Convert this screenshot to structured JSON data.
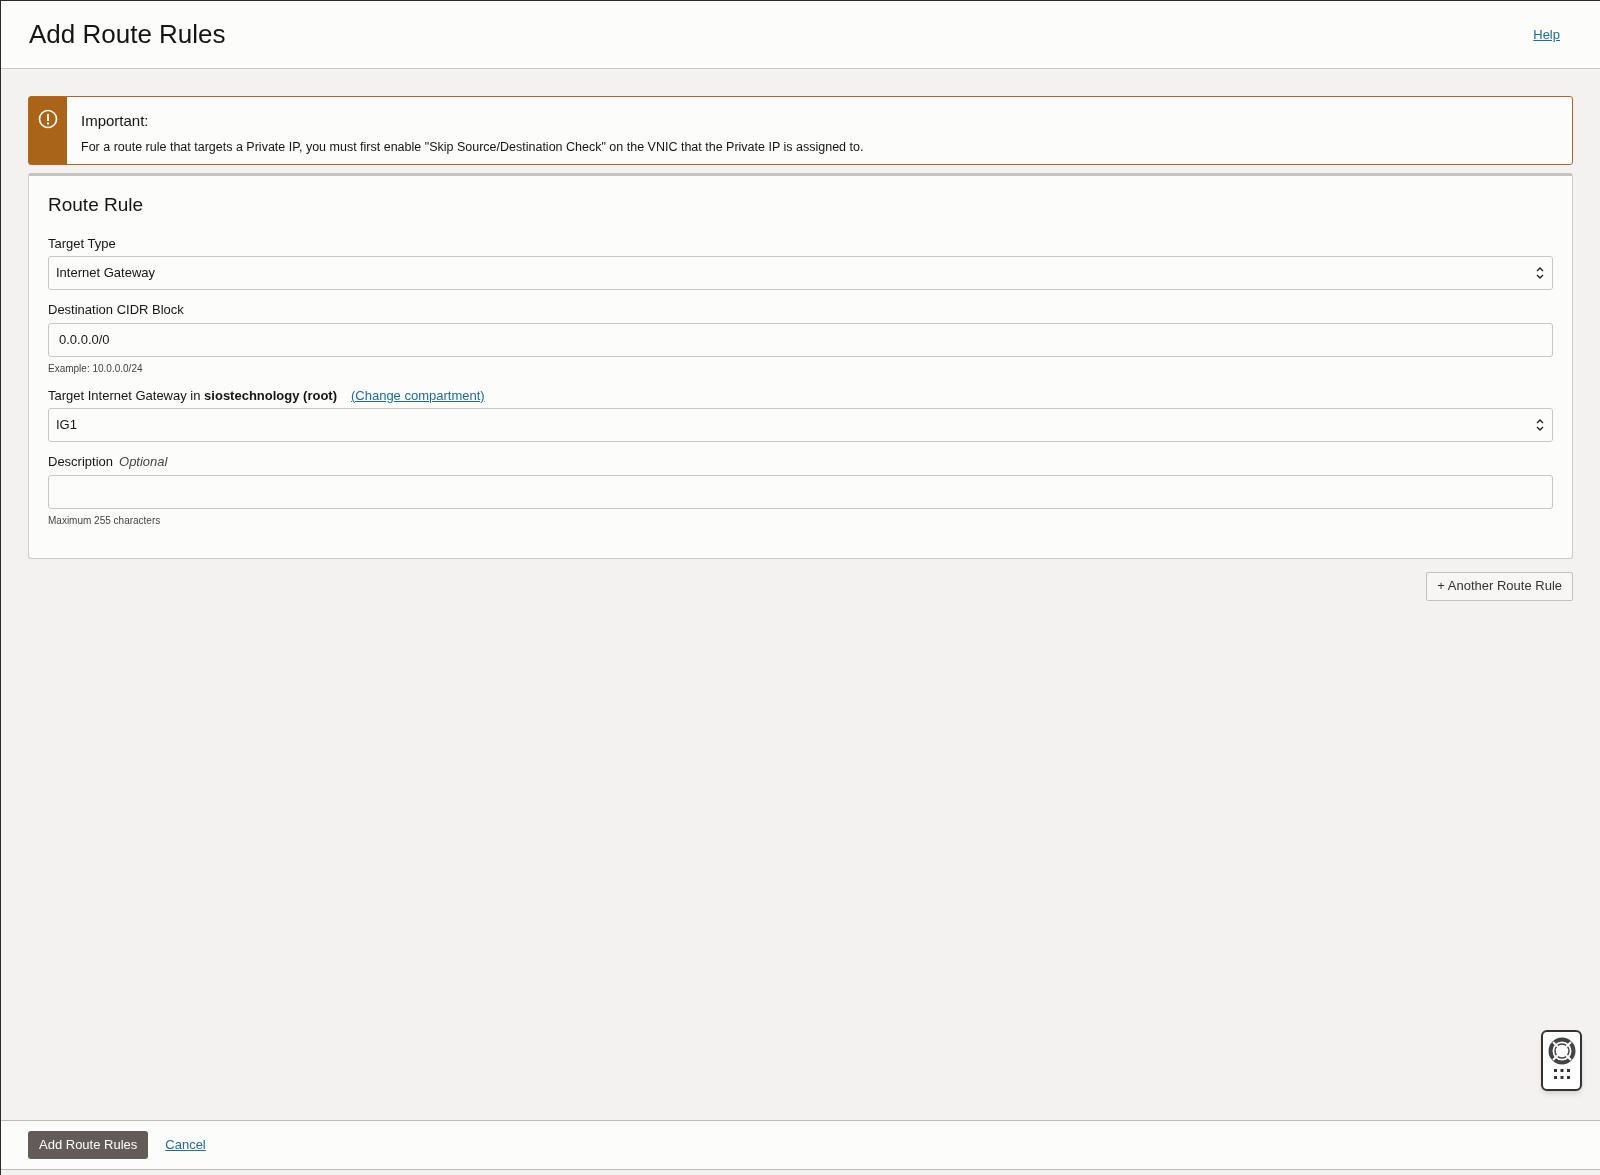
{
  "header": {
    "title": "Add Route Rules",
    "help_link": "Help"
  },
  "alert": {
    "title": "Important:",
    "message": "For a route rule that targets a Private IP, you must first enable \"Skip Source/Destination Check\" on the VNIC that the Private IP is assigned to."
  },
  "route_rule": {
    "title": "Route Rule",
    "fields": [
      {
        "kind": "select",
        "label": "Target Type",
        "value": "Internet Gateway"
      },
      {
        "kind": "text",
        "label": "Destination CIDR Block",
        "value": "0.0.0.0/0",
        "hint": "Example: 10.0.0.0/24"
      },
      {
        "kind": "select",
        "label": "Target Internet Gateway in **siostechnology (root)**",
        "link": "(Change compartment)",
        "value": "IG1"
      },
      {
        "kind": "text",
        "label": "Description",
        "optional": "Optional",
        "hint": "Maximum 255 characters"
      }
    ]
  },
  "another_button": "+ Another Route Rule",
  "footer": {
    "primary_button": "Add Route Rules",
    "cancel_link": "Cancel"
  }
}
